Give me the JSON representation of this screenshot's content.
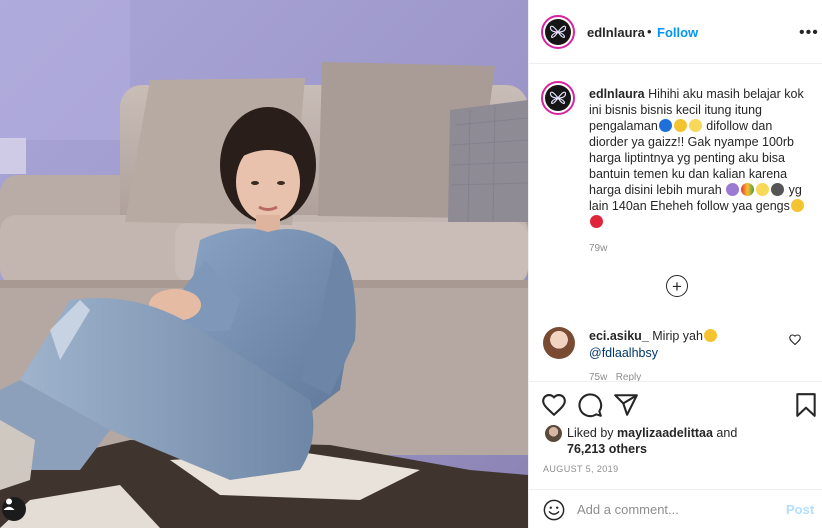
{
  "post": {
    "username": "edlnlaura",
    "separator": "•",
    "follow_label": "Follow",
    "more_label": "•••"
  },
  "caption": {
    "username": "edlnlaura",
    "text_1": "Hihihi aku masih belajar kok ini bisnis bisnis kecil itung itung pengalaman",
    "text_2": " difollow dan diorder ya gaizz!! Gak nyampe 100rb harga liptintnya yg penting aku bisa bantuin temen ku dan kalian karena harga disini lebih murah ",
    "text_3": " yg lain 140an Eheheh follow yaa gengs",
    "time": "79w"
  },
  "load_more_label": "+",
  "comment": {
    "username": "eci.asiku_",
    "text": "Mirip yah",
    "mention": "@fdlaalhbsy",
    "time": "75w",
    "reply_label": "Reply"
  },
  "likes": {
    "prefix": "Liked by",
    "user": "maylizaadelittaa",
    "joiner": "and",
    "others": "76,213 others"
  },
  "date": "AUGUST 5, 2019",
  "add_comment": {
    "placeholder": "Add a comment...",
    "post_label": "Post"
  },
  "icons": {
    "like": "heart-icon",
    "comment": "comment-bubble-icon",
    "share": "paper-plane-icon",
    "save": "bookmark-icon",
    "more": "more-dots-icon",
    "emoji": "smiley-icon",
    "load_more": "plus-circle-icon"
  },
  "colors": {
    "accent": "#0095f6",
    "post_disabled": "#b2dffc",
    "text": "#262626",
    "muted": "#8e8e8e"
  }
}
